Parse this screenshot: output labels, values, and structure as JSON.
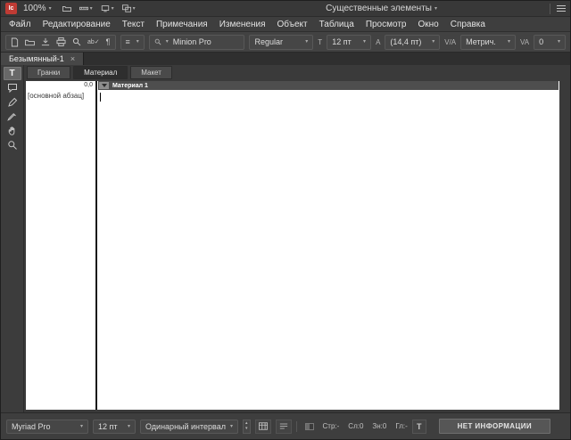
{
  "titlebar": {
    "app_icon_label": "Ic",
    "zoom_level": "100%",
    "workspace_switcher": "Существенные элементы",
    "icons": [
      "bridge-icon",
      "view-options-icon",
      "screen-mode-icon",
      "arrange-documents-icon",
      "panel-menu-icon"
    ]
  },
  "menubar": {
    "items": [
      "Файл",
      "Редактирование",
      "Текст",
      "Примечания",
      "Изменения",
      "Объект",
      "Таблица",
      "Просмотр",
      "Окно",
      "Справка"
    ]
  },
  "toolbar": {
    "icons": [
      "new-document-icon",
      "open-icon",
      "save-icon",
      "print-icon",
      "search-icon",
      "spellcheck-icon",
      "hidden-characters-icon",
      "view-lines-icon"
    ],
    "font_family": "Minion Pro",
    "font_style": "Regular",
    "font_size": "12 пт",
    "leading": "(14,4 пт)",
    "kerning": "Метрич.",
    "tracking": "0",
    "glyphs": {
      "hidden_characters": "¶",
      "view_lines": "≡",
      "spellcheck": "ab✓",
      "font_size_icon": "T",
      "leading_icon": "A",
      "kerning_icon": "V/A",
      "tracking_icon": "VA"
    }
  },
  "document_tab": {
    "title": "Безымянный-1",
    "close_label": "×"
  },
  "view_tabs": {
    "items": [
      "Гранки",
      "Материал",
      "Макет"
    ],
    "active": "Материал"
  },
  "tools": {
    "items": [
      "type-tool",
      "note-tool",
      "pencil-tool",
      "eyedropper-tool",
      "hand-tool",
      "zoom-tool"
    ],
    "active": "type-tool",
    "type_glyph": "T"
  },
  "editor": {
    "depth_marker": "0,0",
    "paragraph_style": "[основной абзац]",
    "story_title": "Материал 1"
  },
  "statusbar": {
    "font_family": "Myriad Pro",
    "font_size": "12 пт",
    "line_spacing": "Одинарный интервал",
    "counters": [
      "Стр:-",
      "Сл:0",
      "Зн:0",
      "Гл:-"
    ],
    "info_label": "НЕТ ИНФОРМАЦИИ",
    "icons": [
      "table-icon",
      "lines-icon",
      "copyfit-progress-icon",
      "overset-text-icon"
    ]
  },
  "colors": {
    "accent_red": "#bf3b34",
    "panel": "#3e3e3e",
    "paper": "#ffffff",
    "story_bar": "#4e4e4e"
  }
}
